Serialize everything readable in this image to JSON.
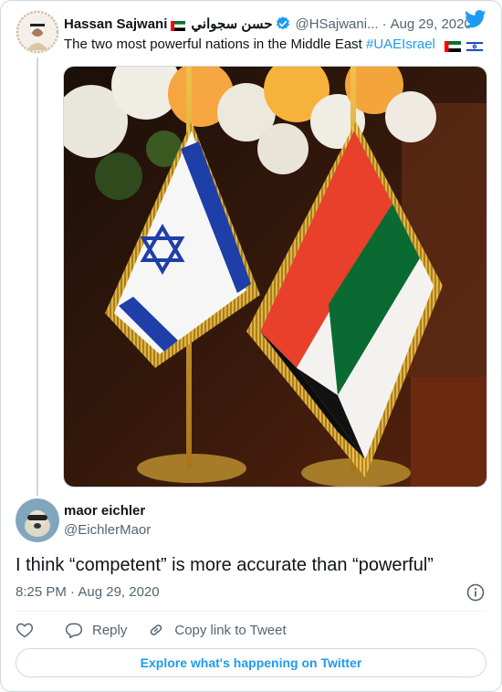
{
  "parent_tweet": {
    "author_name": "Hassan Sajwani",
    "author_name_arabic": "حسن سجواني",
    "handle": "@HSajwani...",
    "separator": "·",
    "date": "Aug 29, 2020",
    "text_prefix": "The two most powerful nations in the Middle East ",
    "hashtag": "#UAEIsrael"
  },
  "reply": {
    "author_name": "maor eichler",
    "handle": "@EichlerMaor",
    "text": "I think “competent” is more accurate than “powerful”",
    "time_date": "8:25 PM · Aug 29, 2020"
  },
  "actions": {
    "reply_label": "Reply",
    "copy_link_label": "Copy link to Tweet"
  },
  "explore_label": "Explore what's happening on Twitter",
  "colors": {
    "accent": "#1d9bf0",
    "text": "#0f1419",
    "muted": "#536471",
    "border": "#cfd9de"
  }
}
